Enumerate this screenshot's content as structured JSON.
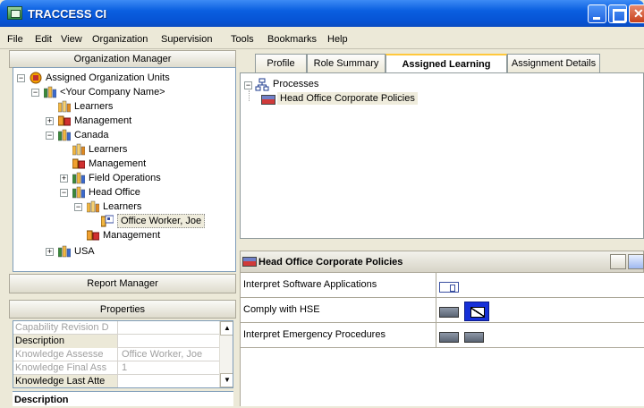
{
  "window": {
    "title": "TRACCESS CI"
  },
  "menu": [
    "File",
    "Edit",
    "View",
    "Organization",
    "Supervision",
    "Tools",
    "Bookmarks",
    "Help"
  ],
  "org_manager": {
    "header": "Organization Manager",
    "tree": [
      {
        "label": "Assigned Organization Units",
        "icon": "org-root-icon",
        "expander": "-"
      },
      {
        "label": "<Your Company Name>",
        "icon": "org-unit-icon",
        "expander": "-"
      },
      {
        "label": "Learners",
        "icon": "learners-icon",
        "expander": ""
      },
      {
        "label": "Management",
        "icon": "management-icon",
        "expander": "+"
      },
      {
        "label": "Canada",
        "icon": "org-unit-icon",
        "expander": "-"
      },
      {
        "label": "Learners",
        "icon": "learners-icon",
        "expander": ""
      },
      {
        "label": "Management",
        "icon": "management-icon",
        "expander": ""
      },
      {
        "label": "Field Operations",
        "icon": "org-unit-icon",
        "expander": "+"
      },
      {
        "label": "Head Office",
        "icon": "org-unit-icon",
        "expander": "-"
      },
      {
        "label": "Learners",
        "icon": "learners-icon",
        "expander": "-"
      },
      {
        "label": "Office Worker, Joe",
        "icon": "person-icon",
        "expander": ""
      },
      {
        "label": "Management",
        "icon": "management-icon",
        "expander": ""
      },
      {
        "label": "USA",
        "icon": "org-unit-icon",
        "expander": "+"
      }
    ]
  },
  "report_manager": {
    "header": "Report Manager"
  },
  "properties": {
    "header": "Properties",
    "rows": [
      {
        "key": "Capability Revision D",
        "value": ""
      },
      {
        "key": "Description",
        "value": ""
      },
      {
        "key": "Knowledge Assesse",
        "value": "Office Worker, Joe"
      },
      {
        "key": "Knowledge Final Ass",
        "value": "1"
      },
      {
        "key": "Knowledge Last Atte",
        "value": ""
      }
    ],
    "description_label": "Description"
  },
  "tabs": [
    "Profile",
    "Role Summary",
    "Assigned Learning",
    "Assignment Details"
  ],
  "active_tab": "Assigned Learning",
  "process_tree": {
    "root": "Processes",
    "children": [
      "Head Office Corporate Policies"
    ]
  },
  "detail": {
    "title": "Head Office Corporate Policies",
    "rows": [
      {
        "name": "Interpret Software Applications",
        "cells": [
          "doc"
        ]
      },
      {
        "name": "Comply with HSE",
        "cells": [
          "gray",
          "selected"
        ]
      },
      {
        "name": "Interpret Emergency Procedures",
        "cells": [
          "gray",
          "gray"
        ]
      }
    ]
  },
  "colors": {
    "titlebar": "#0a5fe0",
    "selection": "#1630d8",
    "tab_active_accent": "#ffc83c"
  }
}
